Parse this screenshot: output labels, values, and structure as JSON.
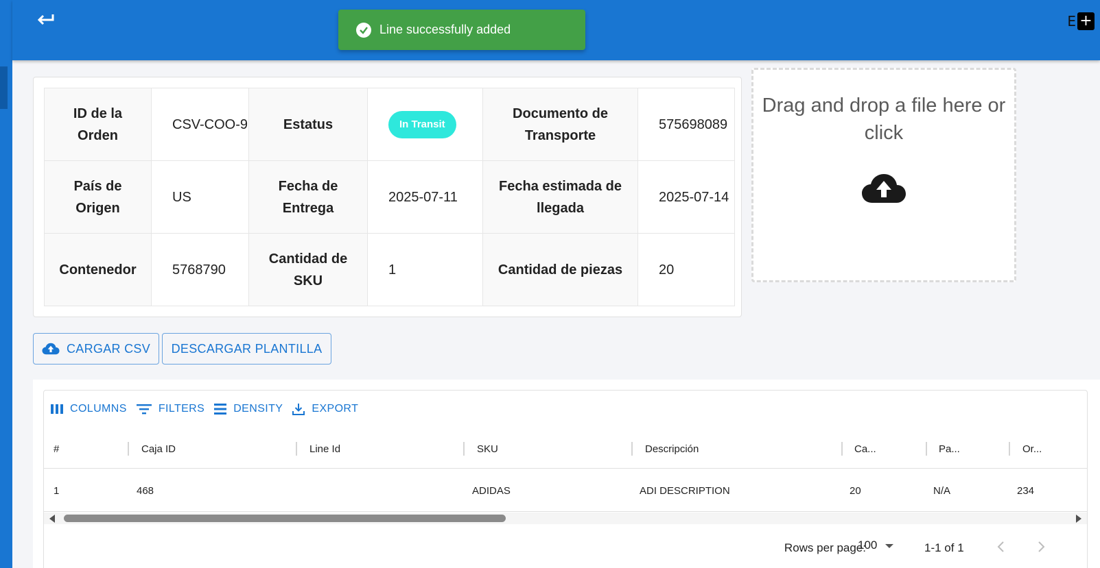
{
  "toast": {
    "message": "Line successfully added"
  },
  "header": {
    "right_partial_text": "E",
    "add_symbol": "+"
  },
  "order_info": {
    "rows": [
      [
        {
          "label": "ID de la Orden",
          "value": "CSV-COO-9"
        },
        {
          "label": "Estatus",
          "value": "In Transit",
          "is_badge": true
        },
        {
          "label": "Documento de Transporte",
          "value": "575698089"
        }
      ],
      [
        {
          "label": "País de Origen",
          "value": "US"
        },
        {
          "label": "Fecha de Entrega",
          "value": "2025-07-11"
        },
        {
          "label": "Fecha estimada de llegada",
          "value": "2025-07-14"
        }
      ],
      [
        {
          "label": "Contenedor",
          "value": "5768790"
        },
        {
          "label": "Cantidad de SKU",
          "value": "1"
        },
        {
          "label": "Cantidad de piezas",
          "value": "20"
        }
      ]
    ],
    "status_color": "#2ee8dc"
  },
  "dropzone": {
    "text": "Drag and drop a file here or click",
    "icon": "cloud-upload-icon"
  },
  "buttons": {
    "upload_csv": "CARGAR CSV",
    "download_template": "DESCARGAR PLANTILLA"
  },
  "grid": {
    "toolbar": {
      "columns": "COLUMNS",
      "filters": "FILTERS",
      "density": "DENSITY",
      "export": "EXPORT"
    },
    "columns": [
      "#",
      "Caja ID",
      "Line Id",
      "SKU",
      "Descripción",
      "Ca...",
      "Pa...",
      "Or..."
    ],
    "rows": [
      [
        "1",
        "468",
        "",
        "ADIDAS",
        "ADI DESCRIPTION",
        "20",
        "N/A",
        "234"
      ]
    ],
    "footer": {
      "rows_per_page_label": "Rows per page:",
      "rows_per_page_value": "100",
      "range": "1-1 of 1"
    }
  },
  "colors": {
    "primary": "#1976d2",
    "success": "#43a047"
  }
}
